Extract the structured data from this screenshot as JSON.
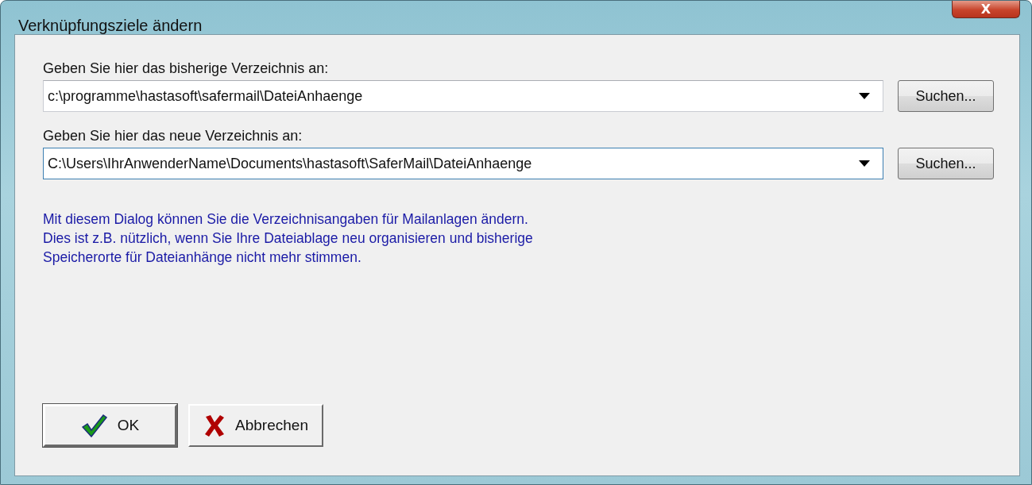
{
  "window": {
    "title": "Verknüpfungsziele ändern",
    "close": "X"
  },
  "fields": [
    {
      "label": "Geben Sie hier das bisherige Verzeichnis an:",
      "value": "c:\\programme\\hastasoft\\safermail\\DateiAnhaenge",
      "focused": false,
      "button": "Suchen..."
    },
    {
      "label": "Geben Sie hier das neue Verzeichnis an:",
      "value": "C:\\Users\\IhrAnwenderName\\Documents\\hastasoft\\SaferMail\\DateiAnhaenge",
      "focused": true,
      "button": "Suchen..."
    }
  ],
  "info": [
    "Mit diesem Dialog können Sie die Verzeichnisangaben für Mailanlagen ändern.",
    "Dies ist z.B. nützlich, wenn Sie Ihre Dateiablage neu organisieren und bisherige",
    "Speicherorte für Dateianhänge nicht mehr stimmen."
  ],
  "buttons": [
    {
      "kind": "ok",
      "label": "OK",
      "default": true
    },
    {
      "kind": "cancel",
      "label": "Abbrechen",
      "default": false
    }
  ]
}
